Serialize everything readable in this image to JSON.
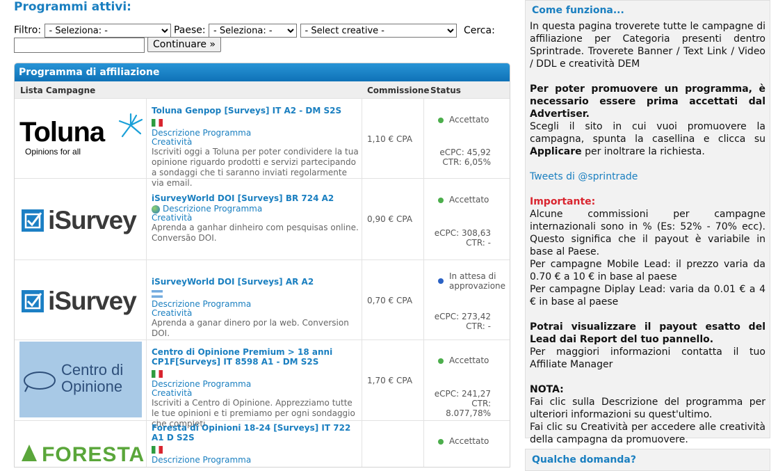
{
  "page_title": "Programmi attivi:",
  "filters": {
    "filter_label": "Filtro:",
    "filter_value": "- Seleziona: -",
    "country_label": "Paese:",
    "country_value": "- Seleziona: -",
    "creative_value": "- Select creative -",
    "search_label": "Cerca:",
    "search_value": "",
    "continue_label": "Continuare »"
  },
  "program_box": {
    "header": "Programma di affiliazione",
    "columns": [
      "Lista Campagne",
      "Commissione",
      "Status"
    ]
  },
  "campaigns": [
    {
      "logo": "Toluna",
      "logo_tagline": "Opinions for all",
      "name": "Toluna Genpop [Surveys] IT A2 - DM S2S",
      "flag": "italy-flag",
      "link_description": "Descrizione Programma",
      "link_creative": "Creatività",
      "description": "Iscriviti oggi a Toluna per poter condividere la tua opinione riguardo prodotti e servizi partecipando a sondaggi che ti saranno inviati regolarmente via email.",
      "commission": "1,10 € CPA",
      "status": "Accettato",
      "ecpc": "eCPC: 45,92",
      "ctr": "CTR: 6,05%"
    },
    {
      "logo": "iSurvey",
      "name": "iSurveyWorld DOI [Surveys] BR 724 A2",
      "flag": "globe-icon",
      "link_description": "Descrizione Programma",
      "link_creative": "Creatività",
      "description": "Aprenda a ganhar dinheiro com pesquisas online. Conversão DOI.",
      "commission": "0,90 € CPA",
      "status": "Accettato",
      "ecpc": "eCPC: 308,63",
      "ctr": "CTR: -"
    },
    {
      "logo": "iSurvey",
      "name": "iSurveyWorld DOI [Surveys] AR A2",
      "flag": "argentina-flag",
      "link_description": "Descrizione Programma",
      "link_creative": "Creatività",
      "description": "Aprenda a ganar dinero por la web. Conversion DOI.",
      "commission": "0,70 € CPA",
      "status": "In attesa di approvazione",
      "ecpc": "eCPC: 273,42",
      "ctr": "CTR: -"
    },
    {
      "logo": "Centro di Opinione",
      "name": "Centro di Opinione Premium > 18 anni CP1F[Surveys] IT 8598 A1 - DM S2S",
      "flag": "italy-flag",
      "link_description": "Descrizione Programma",
      "link_creative": "Creatività",
      "description": "Iscriviti a Centro di Opinione. Apprezziamo tutte le tue opinioni e ti premiamo per ogni sondaggio che completi.",
      "commission": "1,70 € CPA",
      "status": "Accettato",
      "ecpc": "eCPC: 241,27",
      "ctr": "CTR: 8.077,78%"
    },
    {
      "logo": "FORESTA",
      "name": "Foresta di Opinioni 18-24 [Surveys] IT 722 A1 D S2S",
      "flag": "italy-flag",
      "link_description": "Descrizione Programma",
      "status": "Accettato"
    }
  ],
  "sidebar": {
    "title": "Come funziona...",
    "intro": "In questa pagina troverete tutte le campagne di affiliazione per Categoria presenti dentro Sprintrade. Troverete Banner / Text Link / Video / DDL e creatività DEM",
    "bold_promo": "Per poter promuovere un programma, è necessario essere prima accettati dal Advertiser.",
    "choose_text_1": "Scegli il sito in cui vuoi promuovere la campagna, spunta la casellina e clicca su",
    "choose_bold": "Applicare",
    "choose_text_2": "per inoltrare la richiesta.",
    "tweets": "Tweets di @sprintrade",
    "important_label": "Importante:",
    "important_1": "Alcune commissioni per campagne internazionali sono in % (Es: 52% - 70% ecc). Questo significa che il payout è variabile in base al Paese.",
    "important_2": "Per campagne Mobile Lead: il prezzo varia da 0.70 € a 10 € in base al paese",
    "important_3": "Per campagne Diplay Lead: varia da 0.01 € a 4 € in base al paese",
    "payout_bold": "Potrai visualizzare il payout esatto del Lead dai Report del tuo pannello.",
    "payout_info": "Per maggiori informazioni contatta il tuo Affiliate Manager",
    "nota_label": "NOTA:",
    "nota_1": "Fai clic sulla Descrizione del programma per ulteriori informazioni su quest'ultimo.",
    "nota_2": "Fai clic su Creatività per accedere alle creatività della campagna da promuovere."
  },
  "faq_title": "Qualche domanda?"
}
